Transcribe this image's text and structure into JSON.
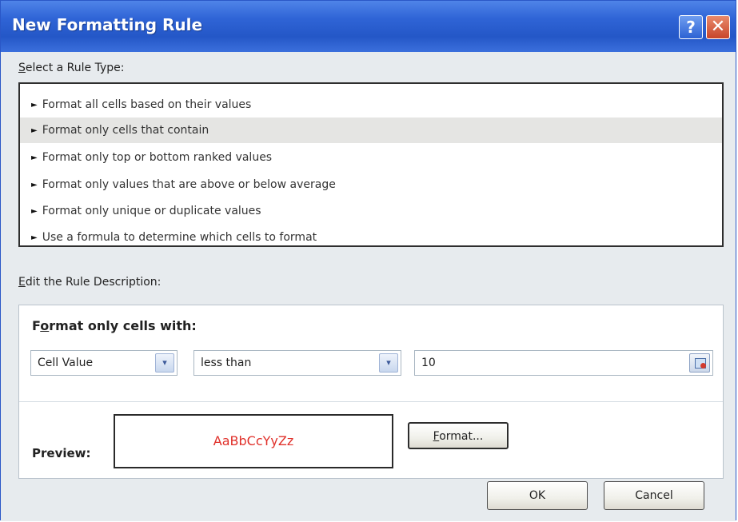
{
  "window": {
    "title": "New Formatting Rule",
    "help_glyph": "?",
    "close_glyph": "✕"
  },
  "rule_type": {
    "label_accel": "S",
    "label_rest": "elect a Rule Type:",
    "items": [
      {
        "label": "Format all cells based on their values",
        "selected": false
      },
      {
        "label": "Format only cells that contain",
        "selected": true
      },
      {
        "label": "Format only top or bottom ranked values",
        "selected": false
      },
      {
        "label": "Format only values that are above or below average",
        "selected": false
      },
      {
        "label": "Format only unique or duplicate values",
        "selected": false
      },
      {
        "label": "Use a formula to determine which cells to format",
        "selected": false
      }
    ]
  },
  "description": {
    "label_accel": "E",
    "label_rest": "dit the Rule Description:",
    "heading_pre": "F",
    "heading_accel": "o",
    "heading_post": "rmat only cells with:",
    "condition_type": "Cell Value",
    "operator": "less than",
    "value": "10",
    "preview_label": "Preview:",
    "preview_sample": "AaBbCcYyZz",
    "preview_color": "#e0302a",
    "format_button_accel": "F",
    "format_button_rest": "ormat..."
  },
  "buttons": {
    "ok": "OK",
    "cancel": "Cancel"
  },
  "icons": {
    "arrow": "►",
    "dropdown": "▾"
  }
}
